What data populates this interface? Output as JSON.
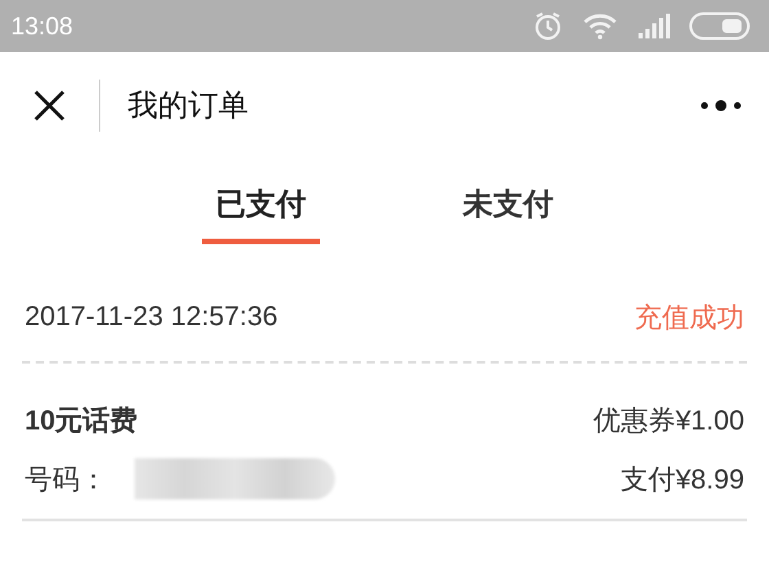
{
  "status_bar": {
    "time": "13:08"
  },
  "nav": {
    "title": "我的订单"
  },
  "tabs": [
    {
      "label": "已支付",
      "selected": true
    },
    {
      "label": "未支付",
      "selected": false
    }
  ],
  "order": {
    "datetime": "2017-11-23 12:57:36",
    "status": "充值成功",
    "product": "10元话费",
    "coupon": "优惠券¥1.00",
    "number_label": "号码：",
    "paid": "支付¥8.99"
  }
}
